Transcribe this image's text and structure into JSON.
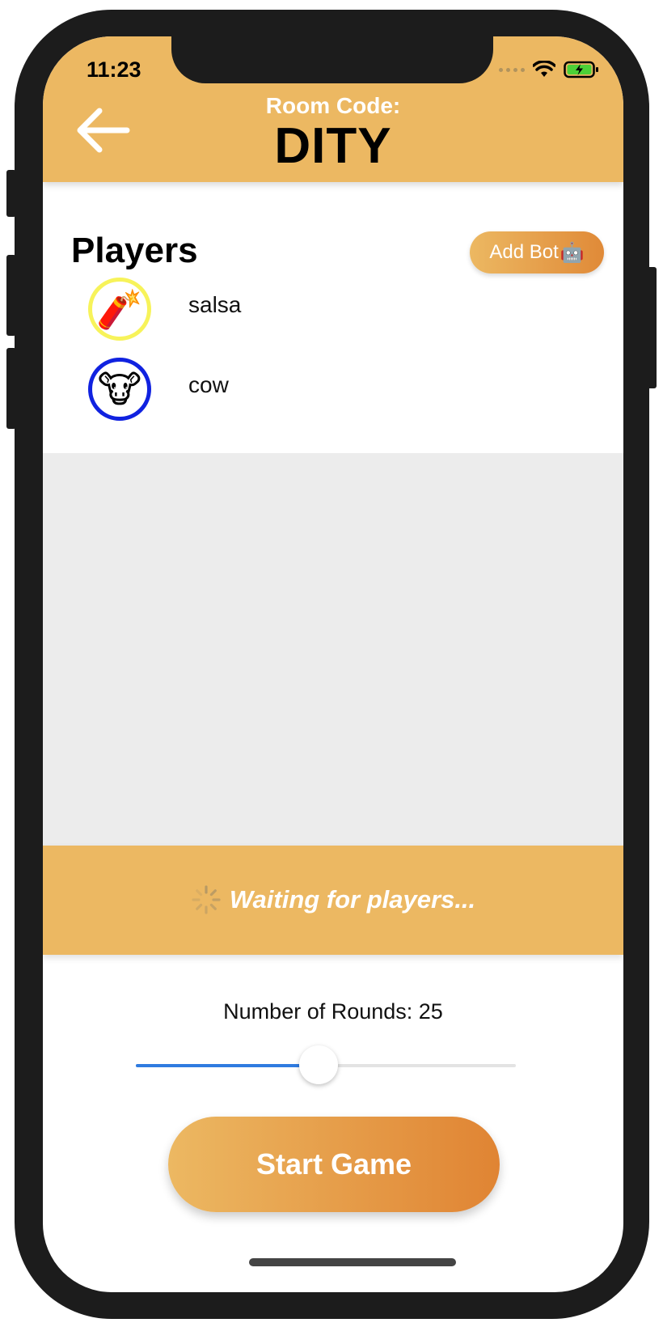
{
  "status_bar": {
    "time": "11:23"
  },
  "header": {
    "room_code_label": "Room Code:",
    "room_code": "DITY"
  },
  "players_section": {
    "title": "Players",
    "add_bot_label": "Add Bot",
    "add_bot_emoji": "🤖",
    "players": [
      {
        "name": "salsa",
        "avatar": "🧨",
        "ring_color": "#f7f35a"
      },
      {
        "name": "cow",
        "avatar": "🐮",
        "ring_color": "#1022e0"
      }
    ]
  },
  "waiting": {
    "text": "Waiting for players..."
  },
  "rounds": {
    "label": "Number of Rounds: 25",
    "slider_fraction": 0.48
  },
  "start_button": {
    "label": "Start Game"
  },
  "colors": {
    "accent": "#ecb862",
    "accent_dark": "#e08433",
    "slider": "#2f7be0"
  }
}
